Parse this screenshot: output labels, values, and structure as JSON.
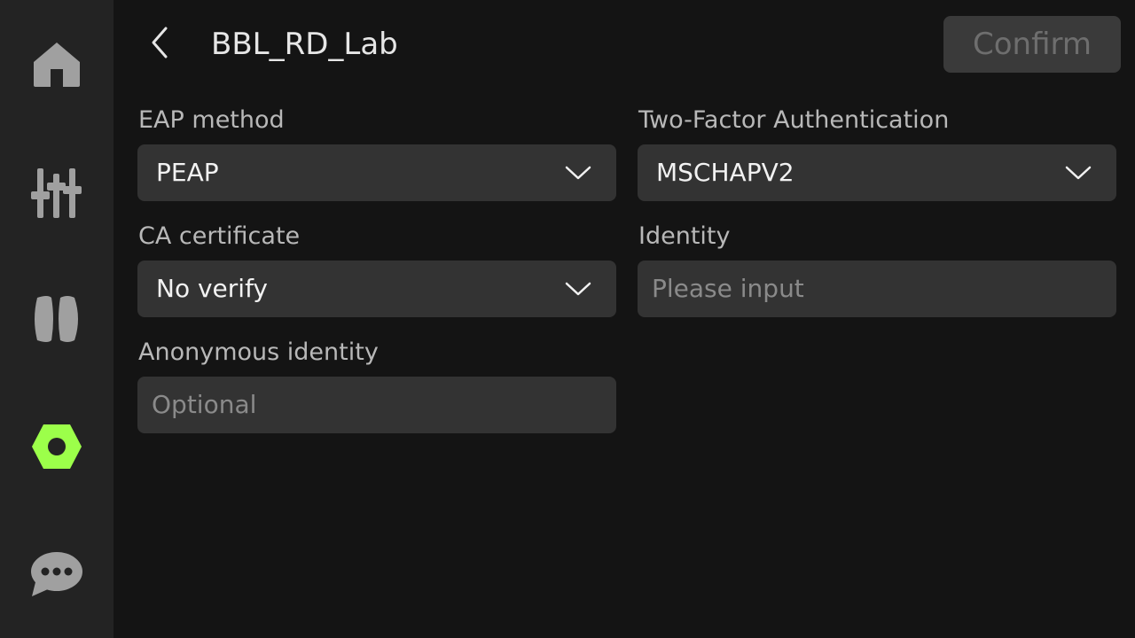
{
  "sidebar": {
    "items": [
      {
        "icon": "home-icon",
        "active": false
      },
      {
        "icon": "sliders-icon",
        "active": false
      },
      {
        "icon": "filament-icon",
        "active": false
      },
      {
        "icon": "settings-icon",
        "active": true
      },
      {
        "icon": "message-icon",
        "active": false
      }
    ],
    "active_color": "#9cff4a",
    "inactive_color": "#a0a0a0"
  },
  "header": {
    "title": "BBL_RD_Lab",
    "confirm_label": "Confirm"
  },
  "form": {
    "eap_method": {
      "label": "EAP method",
      "value": "PEAP"
    },
    "two_factor": {
      "label": "Two-Factor Authentication",
      "value": "MSCHAPV2"
    },
    "ca_certificate": {
      "label": "CA certificate",
      "value": "No verify"
    },
    "identity": {
      "label": "Identity",
      "placeholder": "Please input",
      "value": ""
    },
    "anonymous_identity": {
      "label": "Anonymous identity",
      "placeholder": "Optional",
      "value": ""
    }
  }
}
